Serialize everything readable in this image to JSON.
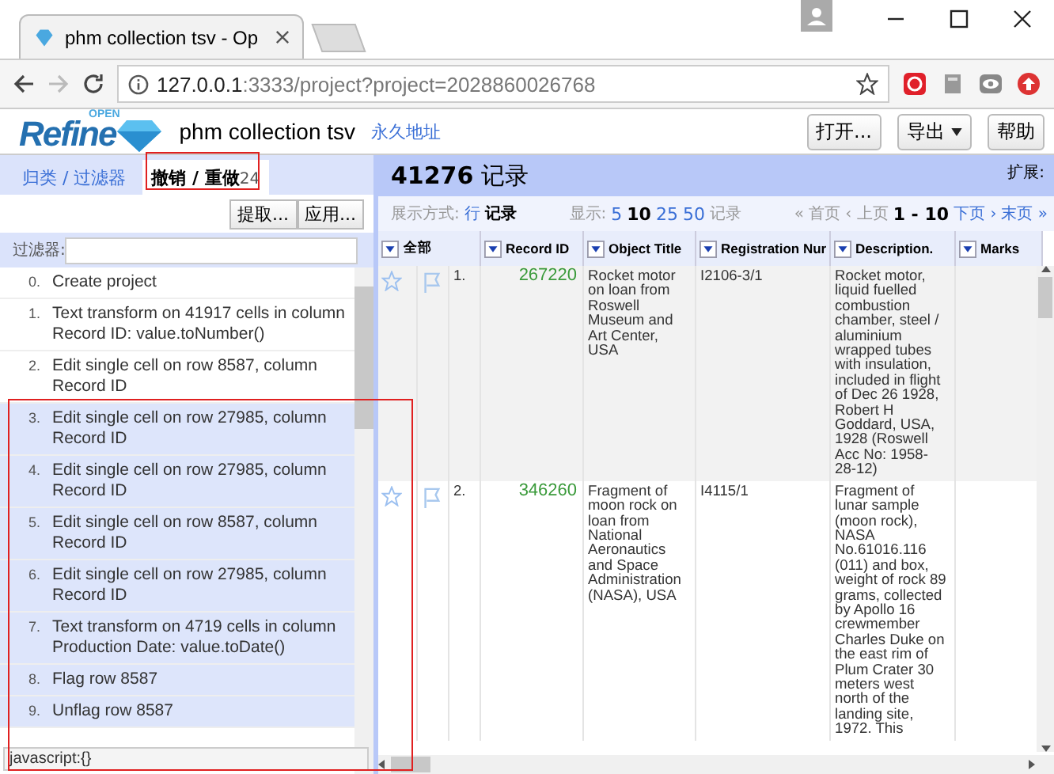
{
  "browser": {
    "tab_title": "phm collection tsv - Op",
    "url_host": "127.0.0.1",
    "url_rest": ":3333/project?project=2028860026768"
  },
  "app_header": {
    "logo_text": "Refine",
    "logo_super": "OPEN",
    "project_name": "phm collection tsv",
    "permalink": "永久地址",
    "buttons": [
      {
        "label": "打开...",
        "dropdown": false
      },
      {
        "label": "导出",
        "dropdown": true
      },
      {
        "label": "帮助",
        "dropdown": false
      }
    ]
  },
  "left_panel": {
    "tabs": [
      {
        "label": "归类 / 过滤器",
        "selected": false
      },
      {
        "label": "撤销 / 重做",
        "count": "24",
        "selected": true
      }
    ],
    "actions": [
      "提取...",
      "应用..."
    ],
    "filter_label": "过滤器:",
    "history": [
      {
        "index": "0.",
        "text": "Create project",
        "done": true
      },
      {
        "index": "1.",
        "text": "Text transform on 41917 cells in column Record ID: value.toNumber()",
        "done": true
      },
      {
        "index": "2.",
        "text": "Edit single cell on row 8587, column Record ID",
        "done": true
      },
      {
        "index": "3.",
        "text": "Edit single cell on row 27985, column Record ID",
        "done": false
      },
      {
        "index": "4.",
        "text": "Edit single cell on row 27985, column Record ID",
        "done": false
      },
      {
        "index": "5.",
        "text": "Edit single cell on row 8587, column Record ID",
        "done": false
      },
      {
        "index": "6.",
        "text": "Edit single cell on row 27985, column Record ID",
        "done": false
      },
      {
        "index": "7.",
        "text": "Text transform on 4719 cells in column Production Date: value.toDate()",
        "done": false
      },
      {
        "index": "8.",
        "text": "Flag row 8587",
        "done": false
      },
      {
        "index": "9.",
        "text": "Unflag row 8587",
        "done": false
      }
    ]
  },
  "status_bar": "javascript:{}",
  "right_panel": {
    "count": "41276",
    "count_unit": "记录",
    "extensions_label": "扩展:",
    "view_label": "展示方式:",
    "view_modes": [
      {
        "label": "行",
        "selected": false
      },
      {
        "label": "记录",
        "selected": true
      }
    ],
    "show_label": "显示:",
    "page_sizes": [
      {
        "label": "5",
        "selected": false
      },
      {
        "label": "10",
        "selected": true
      },
      {
        "label": "25",
        "selected": false
      },
      {
        "label": "50",
        "selected": false
      }
    ],
    "show_unit": "记录",
    "pager": {
      "first": "« 首页",
      "prev": "‹ 上页",
      "range": "1 - 10",
      "next": "下页 ›",
      "last": "末页 »"
    },
    "table": {
      "all_column": "全部",
      "columns": [
        "Record ID",
        "Object Title",
        "Registration Nur",
        "Description.",
        "Marks"
      ],
      "rows": [
        {
          "starred": false,
          "flagged": false,
          "index": "1.",
          "cells": [
            "267220",
            "Rocket motor on loan from Roswell Museum and Art Center, USA",
            "I2106-3/1",
            "Rocket motor, liquid fuelled combustion chamber, steel / aluminium wrapped tubes with insulation, included in flight of Dec 26 1928, Robert H Goddard, USA, 1928 (Roswell Acc No: 1958-28-12)"
          ]
        },
        {
          "starred": false,
          "flagged": false,
          "index": "2.",
          "cells": [
            "346260",
            "Fragment of moon rock on loan from National Aeronautics and Space Administration (NASA), USA",
            "I4115/1",
            "Fragment of lunar sample (moon rock), NASA No.61016.116 (011) and box, weight of rock 89 grams, collected by Apollo 16 crewmember Charles Duke on the east rim of Plum Crater 30 meters west north of the landing site, 1972. This"
          ]
        }
      ]
    }
  }
}
